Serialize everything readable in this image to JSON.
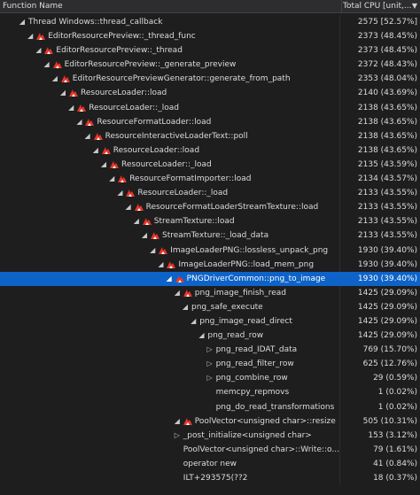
{
  "header": {
    "function_name": "Function Name",
    "total_cpu": "Total CPU [unit,...",
    "sort_icon": "chevron-down-icon"
  },
  "rows": [
    {
      "indent": 0,
      "expander": "expanded",
      "hot": false,
      "name": "Thread Windows::thread_callback",
      "cpu": "2575 [52.57%]"
    },
    {
      "indent": 1,
      "expander": "expanded",
      "hot": true,
      "name": "EditorResourcePreview::_thread_func",
      "cpu": "2373 (48.45%)"
    },
    {
      "indent": 2,
      "expander": "expanded",
      "hot": true,
      "name": "EditorResourcePreview::_thread",
      "cpu": "2373 (48.45%)"
    },
    {
      "indent": 3,
      "expander": "expanded",
      "hot": true,
      "name": "EditorResourcePreview::_generate_preview",
      "cpu": "2372 (48.43%)"
    },
    {
      "indent": 4,
      "expander": "expanded",
      "hot": true,
      "name": "EditorResourcePreviewGenerator::generate_from_path",
      "cpu": "2353 (48.04%)"
    },
    {
      "indent": 5,
      "expander": "expanded",
      "hot": true,
      "name": "ResourceLoader::load",
      "cpu": "2140 (43.69%)"
    },
    {
      "indent": 6,
      "expander": "expanded",
      "hot": true,
      "name": "ResourceLoader::_load",
      "cpu": "2138 (43.65%)"
    },
    {
      "indent": 7,
      "expander": "expanded",
      "hot": true,
      "name": "ResourceFormatLoader::load",
      "cpu": "2138 (43.65%)"
    },
    {
      "indent": 8,
      "expander": "expanded",
      "hot": true,
      "name": "ResourceInteractiveLoaderText::poll",
      "cpu": "2138 (43.65%)"
    },
    {
      "indent": 9,
      "expander": "expanded",
      "hot": true,
      "name": "ResourceLoader::load",
      "cpu": "2138 (43.65%)"
    },
    {
      "indent": 10,
      "expander": "expanded",
      "hot": true,
      "name": "ResourceLoader::_load",
      "cpu": "2135 (43.59%)"
    },
    {
      "indent": 11,
      "expander": "expanded",
      "hot": true,
      "name": "ResourceFormatImporter::load",
      "cpu": "2134 (43.57%)"
    },
    {
      "indent": 12,
      "expander": "expanded",
      "hot": true,
      "name": "ResourceLoader::_load",
      "cpu": "2133 (43.55%)"
    },
    {
      "indent": 13,
      "expander": "expanded",
      "hot": true,
      "name": "ResourceFormatLoaderStreamTexture::load",
      "cpu": "2133 (43.55%)"
    },
    {
      "indent": 14,
      "expander": "expanded",
      "hot": true,
      "name": "StreamTexture::load",
      "cpu": "2133 (43.55%)"
    },
    {
      "indent": 15,
      "expander": "expanded",
      "hot": true,
      "name": "StreamTexture::_load_data",
      "cpu": "2133 (43.55%)"
    },
    {
      "indent": 16,
      "expander": "expanded",
      "hot": true,
      "name": "ImageLoaderPNG::lossless_unpack_png",
      "cpu": "1930 (39.40%)"
    },
    {
      "indent": 17,
      "expander": "expanded",
      "hot": true,
      "name": "ImageLoaderPNG::load_mem_png",
      "cpu": "1930 (39.40%)"
    },
    {
      "indent": 18,
      "expander": "expanded",
      "hot": true,
      "name": "PNGDriverCommon::png_to_image",
      "cpu": "1930 (39.40%)",
      "selected": true
    },
    {
      "indent": 19,
      "expander": "expanded",
      "hot": true,
      "name": "png_image_finish_read",
      "cpu": "1425 (29.09%)"
    },
    {
      "indent": 20,
      "expander": "expanded",
      "hot": false,
      "name": "png_safe_execute",
      "cpu": "1425 (29.09%)"
    },
    {
      "indent": 21,
      "expander": "expanded",
      "hot": false,
      "name": "png_image_read_direct",
      "cpu": "1425 (29.09%)"
    },
    {
      "indent": 22,
      "expander": "expanded",
      "hot": false,
      "name": "png_read_row",
      "cpu": "1425 (29.09%)"
    },
    {
      "indent": 23,
      "expander": "collapsed",
      "hot": false,
      "name": "png_read_IDAT_data",
      "cpu": "769 (15.70%)"
    },
    {
      "indent": 23,
      "expander": "collapsed",
      "hot": false,
      "name": "png_read_filter_row",
      "cpu": "625 (12.76%)"
    },
    {
      "indent": 23,
      "expander": "collapsed",
      "hot": false,
      "name": "png_combine_row",
      "cpu": "29 (0.59%)"
    },
    {
      "indent": 23,
      "expander": "none",
      "hot": false,
      "name": "memcpy_repmovs",
      "cpu": "1 (0.02%)"
    },
    {
      "indent": 23,
      "expander": "none",
      "hot": false,
      "name": "png_do_read_transformations",
      "cpu": "1 (0.02%)"
    },
    {
      "indent": 19,
      "expander": "expanded",
      "hot": true,
      "name": "PoolVector<unsigned char>::resize",
      "cpu": "505 (10.31%)"
    },
    {
      "indent": 19,
      "expander": "collapsed",
      "hot": false,
      "name": "_post_initialize<unsigned char>",
      "cpu": "153 (3.12%)"
    },
    {
      "indent": 19,
      "expander": "none",
      "hot": false,
      "name": "PoolVector<unsigned char>::Write::o...",
      "cpu": "79 (1.61%)"
    },
    {
      "indent": 19,
      "expander": "none",
      "hot": false,
      "name": "operator new",
      "cpu": "41 (0.84%)"
    },
    {
      "indent": 19,
      "expander": "none",
      "hot": false,
      "name": "ILT+293575(??2",
      "cpu": "18 (0.37%)"
    }
  ],
  "colors": {
    "background": "#1e1e1e",
    "selected": "#0e63c8",
    "hot_path": "#e8372b"
  },
  "icons": {
    "expanded": "expanded-arrow-icon",
    "collapsed": "collapsed-arrow-icon",
    "hot": "hot-path-flame-icon"
  }
}
